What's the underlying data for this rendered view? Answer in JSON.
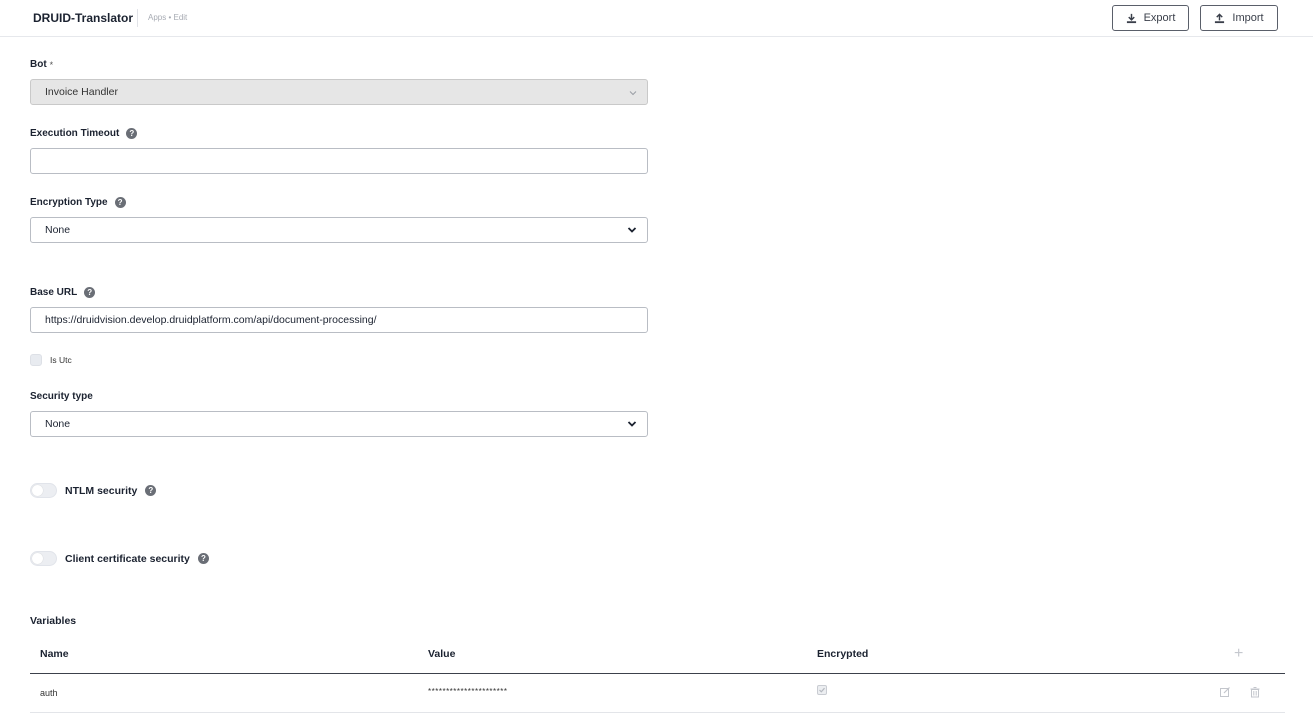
{
  "header": {
    "app_title": "DRUID-Translator",
    "breadcrumb": "Apps • Edit",
    "export_label": "Export",
    "import_label": "Import"
  },
  "form": {
    "bot": {
      "label": "Bot",
      "required_mark": "*",
      "value": "Invoice Handler"
    },
    "execution_timeout": {
      "label": "Execution Timeout",
      "value": ""
    },
    "encryption_type": {
      "label": "Encryption Type",
      "value": "None"
    },
    "base_url": {
      "label": "Base URL",
      "value": "https://druidvision.develop.druidplatform.com/api/document-processing/"
    },
    "is_utc": {
      "label": "Is Utc",
      "checked": false
    },
    "security_type": {
      "label": "Security type",
      "value": "None"
    },
    "ntlm_security": {
      "label": "NTLM security",
      "enabled": false
    },
    "client_certificate_security": {
      "label": "Client certificate security",
      "enabled": false
    }
  },
  "variables": {
    "title": "Variables",
    "columns": [
      "Name",
      "Value",
      "Encrypted"
    ],
    "rows": [
      {
        "name": "auth",
        "value": "**********************",
        "encrypted": true
      }
    ]
  },
  "icons": {
    "export": "download-icon",
    "import": "upload-icon",
    "help": "question-circle-icon",
    "add": "plus-icon",
    "edit": "edit-icon",
    "delete": "trash-icon"
  }
}
